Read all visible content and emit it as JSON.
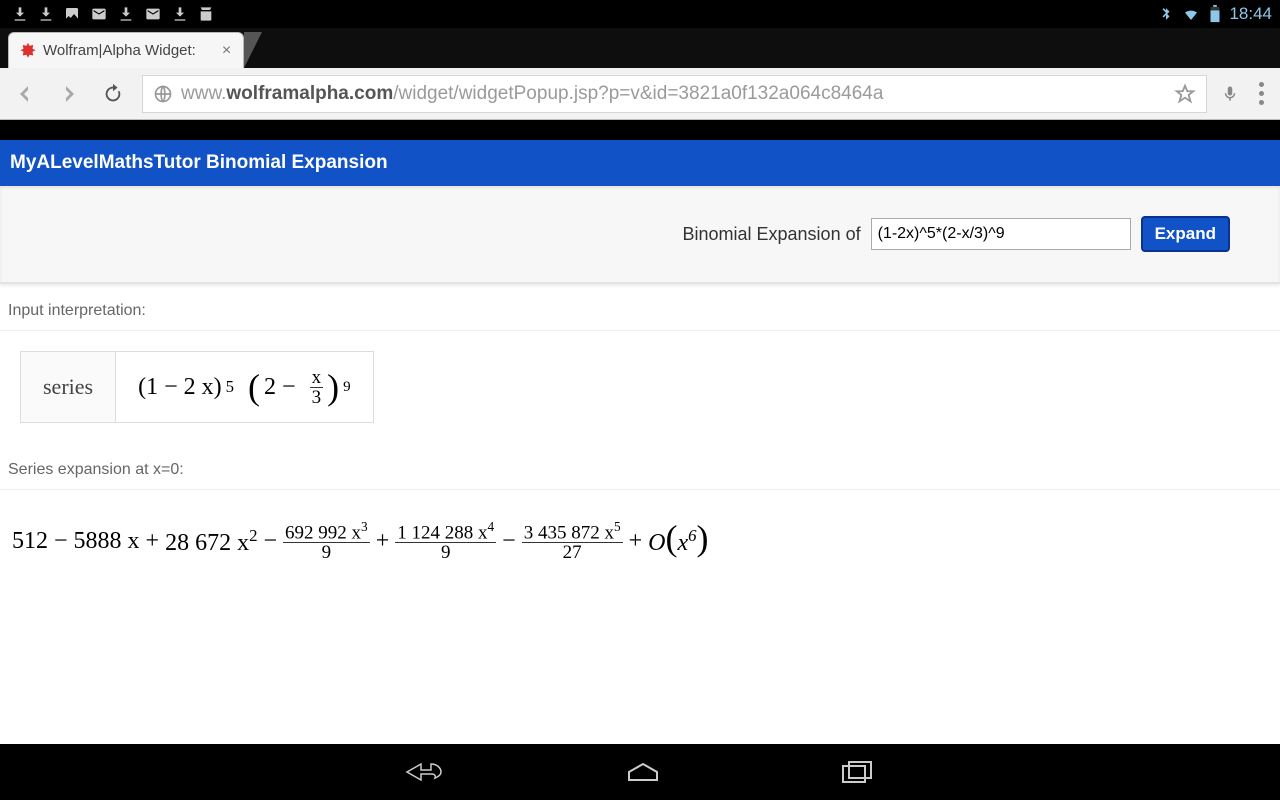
{
  "status": {
    "time": "18:44"
  },
  "tab": {
    "title": "Wolfram|Alpha Widget:"
  },
  "url": {
    "pre": "www.",
    "bold": "wolframalpha.com",
    "post": "/widget/widgetPopup.jsp?p=v&id=3821a0f132a064c8464a"
  },
  "widget": {
    "title": "MyALevelMathsTutor Binomial Expansion",
    "input_label": "Binomial Expansion of",
    "input_value": "(1-2x)^5*(2-x/3)^9",
    "button": "Expand"
  },
  "sections": {
    "interp_label": "Input interpretation:",
    "series_label": "Series expansion at x=0:",
    "interp_prefix": "series"
  },
  "math": {
    "base1": "(1 − 2 x)",
    "exp1": "5",
    "paren_inner_left": "2 −",
    "frac_num": "x",
    "frac_den": "3",
    "exp2": "9",
    "t0": "512",
    "op1": "−",
    "t1": "5888 x",
    "op2": "+",
    "t2": "28 672 x",
    "t2e": "2",
    "op3": "−",
    "t3n": "692 992 x",
    "t3e": "3",
    "t3d": "9",
    "op4": "+",
    "t4n": "1 124 288 x",
    "t4e": "4",
    "t4d": "9",
    "op5": "−",
    "t5n": "3 435 872 x",
    "t5e": "5",
    "t5d": "27",
    "op6": "+",
    "bigO_pre": "O",
    "bigO_inner": "x",
    "bigO_e": "6"
  }
}
